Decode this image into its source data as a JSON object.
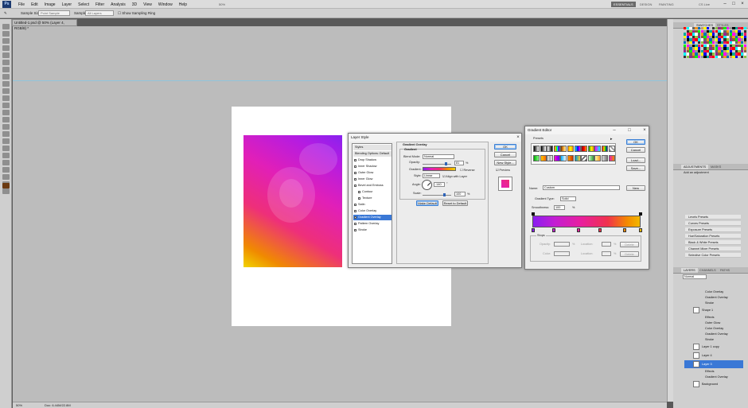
{
  "menubar": {
    "logo": "Ps",
    "menus": [
      "File",
      "Edit",
      "Image",
      "Layer",
      "Select",
      "Filter",
      "Analysis",
      "3D",
      "View",
      "Window",
      "Help"
    ],
    "zoom": "50%",
    "workspaces": [
      "ESSENTIALS",
      "DESIGN",
      "PAINTING"
    ],
    "cslive": "CS Live"
  },
  "options": {
    "sample_size_label": "Sample Size:",
    "sample_size_value": "Point Sample",
    "sample_label": "Sample:",
    "sample_value": "All Layers",
    "sampling_ring_label": "Show Sampling Ring"
  },
  "document": {
    "tab_title": "Untitled-1.psd @ 50% (Layer 4, RGB/8) *",
    "status_zoom": "50%",
    "status_doc": "Doc: 6.44M/22.8M"
  },
  "panels": {
    "swatches_tabs": [
      "SWATCHES",
      "STYLES"
    ],
    "adjustments_tabs": [
      "ADJUSTMENTS",
      "MASKS"
    ],
    "add_adjustment": "Add an adjustment",
    "presets": [
      "Levels Presets",
      "Curves Presets",
      "Exposure Presets",
      "Hue/Saturation Presets",
      "Black & White Presets",
      "Channel Mixer Presets",
      "Selective Color Presets"
    ],
    "layers_tabs": [
      "LAYERS",
      "CHANNELS",
      "PATHS"
    ],
    "blend_mode": "Normal",
    "layers": [
      {
        "name": "Color Overlay",
        "kind": "fx"
      },
      {
        "name": "Gradient Overlay",
        "kind": "fx"
      },
      {
        "name": "Stroke",
        "kind": "fx"
      },
      {
        "name": "Shape 1",
        "kind": "layer"
      },
      {
        "name": "Effects",
        "kind": "fx"
      },
      {
        "name": "Outer Glow",
        "kind": "fx"
      },
      {
        "name": "Color Overlay",
        "kind": "fx"
      },
      {
        "name": "Gradient Overlay",
        "kind": "fx"
      },
      {
        "name": "Stroke",
        "kind": "fx"
      },
      {
        "name": "Layer 1 copy",
        "kind": "layer"
      },
      {
        "name": "Layer 4",
        "kind": "layer"
      },
      {
        "name": "Layer 3",
        "kind": "layer",
        "selected": true
      },
      {
        "name": "Effects",
        "kind": "fx"
      },
      {
        "name": "Gradient Overlay",
        "kind": "fx"
      },
      {
        "name": "Background",
        "kind": "layer"
      }
    ]
  },
  "layer_style": {
    "title": "Layer Style",
    "list": [
      "Styles",
      "Blending Options: Default",
      "Drop Shadow",
      "Inner Shadow",
      "Outer Glow",
      "Inner Glow",
      "Bevel and Emboss",
      "Contour",
      "Texture",
      "Satin",
      "Color Overlay",
      "Gradient Overlay",
      "Pattern Overlay",
      "Stroke"
    ],
    "selected": "Gradient Overlay",
    "section_title": "Gradient Overlay",
    "group_title": "Gradient",
    "blend_mode_label": "Blend Mode:",
    "blend_mode_value": "Normal",
    "opacity_label": "Opacity:",
    "opacity_value": "81",
    "pct": "%",
    "gradient_label": "Gradient:",
    "reverse_label": "Reverse",
    "style_label": "Style:",
    "style_value": "Linear",
    "align_label": "Align with Layer",
    "angle_label": "Angle:",
    "angle_value": "-140",
    "deg": "°",
    "scale_label": "Scale:",
    "scale_value": "100",
    "make_default": "Make Default",
    "reset_default": "Reset to Default",
    "ok": "OK",
    "cancel": "Cancel",
    "new_style": "New Style...",
    "preview": "Preview"
  },
  "gradient_editor": {
    "title": "Gradient Editor",
    "presets_label": "Presets",
    "ok": "OK",
    "cancel": "Cancel",
    "load": "Load...",
    "save": "Save...",
    "name_label": "Name:",
    "name_value": "Custom",
    "new_button": "New",
    "type_label": "Gradient Type:",
    "type_value": "Solid",
    "smooth_label": "Smoothness:",
    "smooth_value": "100",
    "pct": "%",
    "stops_label": "Stops",
    "opacity_label": "Opacity:",
    "location_label": "Location:",
    "delete_label": "Delete",
    "color_label": "Color:"
  },
  "colors": {
    "grad_purple": "#8a1ef0",
    "grad_magenta": "#e41fb5",
    "grad_orange": "#f48a00",
    "grad_yellow": "#f2d100",
    "selection_blue": "#3a78d6"
  }
}
